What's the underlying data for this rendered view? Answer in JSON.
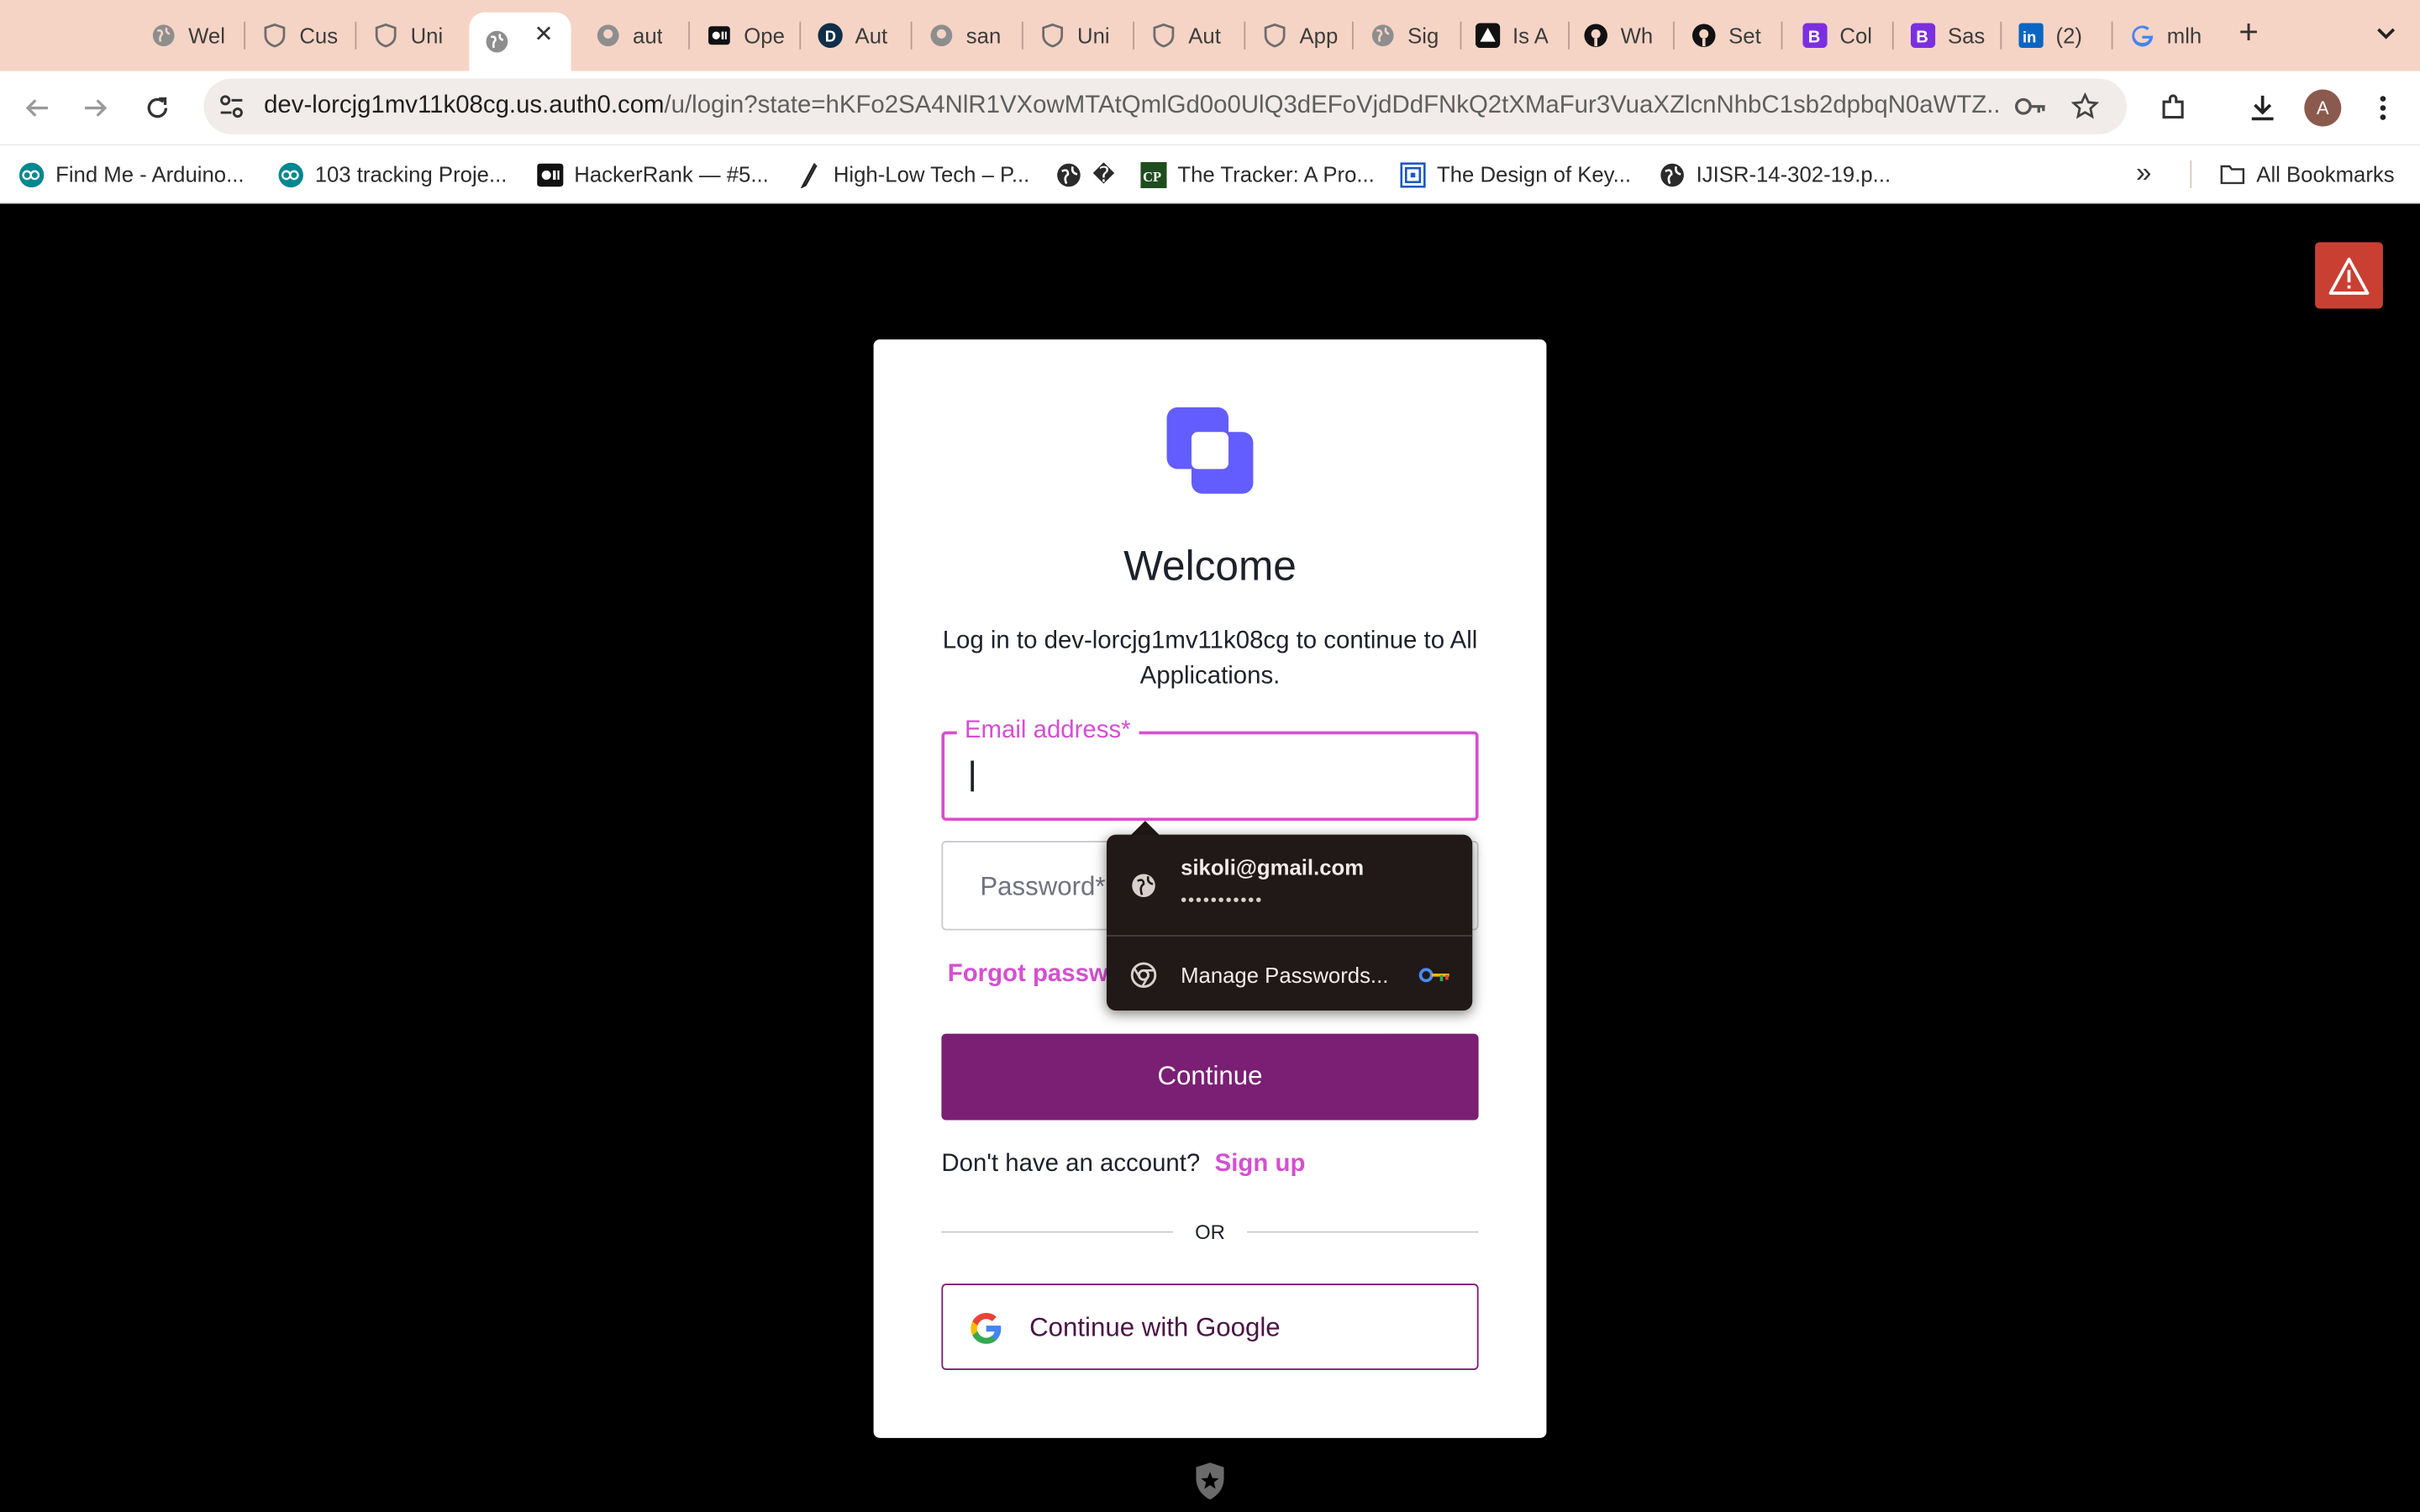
{
  "browser": {
    "tabs": [
      {
        "label": "Wel",
        "icon": "globe-icon"
      },
      {
        "label": "Cus",
        "icon": "shield-icon"
      },
      {
        "label": "Uni",
        "icon": "shield-icon"
      },
      {
        "label": "",
        "icon": "globe-icon",
        "active": true
      },
      {
        "label": "aut",
        "icon": "github-icon"
      },
      {
        "label": "Ope",
        "icon": "medium-icon"
      },
      {
        "label": "Aut",
        "icon": "d-icon"
      },
      {
        "label": "san",
        "icon": "github-icon"
      },
      {
        "label": "Uni",
        "icon": "shield-icon"
      },
      {
        "label": "Aut",
        "icon": "shield-icon"
      },
      {
        "label": "App",
        "icon": "shield-icon"
      },
      {
        "label": "Sig",
        "icon": "globe-icon"
      },
      {
        "label": "Is A",
        "icon": "vercel-icon"
      },
      {
        "label": "Wh",
        "icon": "github-icon"
      },
      {
        "label": "Set",
        "icon": "github-icon"
      },
      {
        "label": "Col",
        "icon": "b-icon"
      },
      {
        "label": "Sas",
        "icon": "b-icon"
      },
      {
        "label": "(2)",
        "icon": "linkedin-icon"
      },
      {
        "label": "mlh",
        "icon": "google-icon"
      }
    ],
    "url_host": "dev-lorcjg1mv11k08cg.us.auth0.com",
    "url_path": "/u/login?state=hKFo2SA4NlR1VXowMTAtQmlGd0o0UlQ3dEFoVjdDdFNkQ2tXMaFur3VuaXZlcnNhbC1sb2dpbqN0aWTZ...",
    "avatar_letter": "A",
    "bookmarks": [
      {
        "label": "Find Me - Arduino...",
        "icon": "arduino-icon"
      },
      {
        "label": "103 tracking Proje...",
        "icon": "arduino-icon"
      },
      {
        "label": "HackerRank — #5...",
        "icon": "medium-icon"
      },
      {
        "label": "High-Low Tech – P...",
        "icon": "pen-icon"
      },
      {
        "label": "�",
        "icon": "globe-icon"
      },
      {
        "label": "The Tracker: A Pro...",
        "icon": "cp-icon"
      },
      {
        "label": "The Design of Key...",
        "icon": "spiral-icon"
      },
      {
        "label": "IJISR-14-302-19.p...",
        "icon": "globe-icon"
      }
    ],
    "all_bookmarks_label": "All Bookmarks"
  },
  "login": {
    "title": "Welcome",
    "subtitle": "Log in to dev-lorcjg1mv11k08cg to continue to All Applications.",
    "email_label": "Email address*",
    "email_value": "",
    "password_placeholder": "Password*",
    "forgot_label": "Forgot password?",
    "continue_label": "Continue",
    "no_account_text": "Don't have an account?",
    "signup_label": "Sign up",
    "or_label": "OR",
    "google_label": "Continue with Google"
  },
  "autofill": {
    "email": "sikoli@gmail.com",
    "password_mask": "•••••••••••",
    "manage_label": "Manage Passwords..."
  },
  "colors": {
    "accent": "#d44fd0",
    "primary_button": "#7a1f74",
    "logo": "#635dff"
  }
}
